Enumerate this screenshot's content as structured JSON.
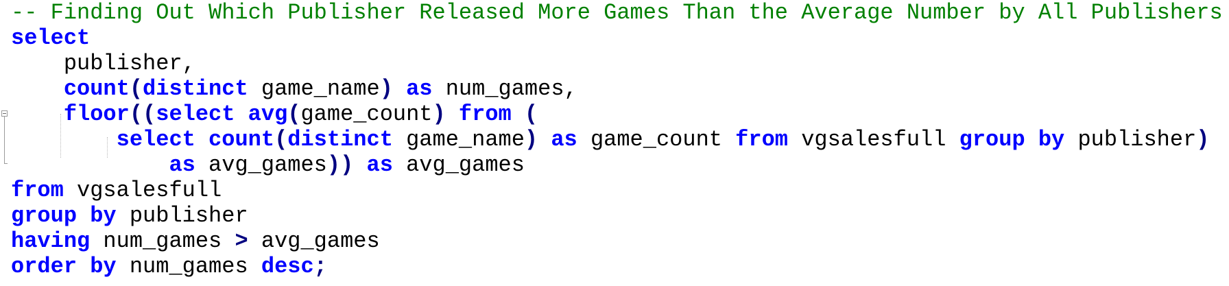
{
  "editor": {
    "lines": [
      [
        {
          "t": "comment",
          "v": "-- Finding Out Which Publisher Released More Games Than the Average Number by All Publishers"
        }
      ],
      [
        {
          "t": "kw",
          "v": "select"
        }
      ],
      [
        {
          "t": "id",
          "v": "    publisher,"
        }
      ],
      [
        {
          "t": "id",
          "v": "    "
        },
        {
          "t": "kw",
          "v": "count"
        },
        {
          "t": "op",
          "v": "("
        },
        {
          "t": "kw",
          "v": "distinct"
        },
        {
          "t": "id",
          "v": " game_name"
        },
        {
          "t": "op",
          "v": ")"
        },
        {
          "t": "id",
          "v": " "
        },
        {
          "t": "kw",
          "v": "as"
        },
        {
          "t": "id",
          "v": " num_games,"
        }
      ],
      [
        {
          "t": "id",
          "v": "    "
        },
        {
          "t": "kw",
          "v": "floor"
        },
        {
          "t": "op",
          "v": "(("
        },
        {
          "t": "kw",
          "v": "select"
        },
        {
          "t": "id",
          "v": " "
        },
        {
          "t": "kw",
          "v": "avg"
        },
        {
          "t": "op",
          "v": "("
        },
        {
          "t": "id",
          "v": "game_count"
        },
        {
          "t": "op",
          "v": ")"
        },
        {
          "t": "id",
          "v": " "
        },
        {
          "t": "kw",
          "v": "from"
        },
        {
          "t": "id",
          "v": " "
        },
        {
          "t": "op",
          "v": "("
        }
      ],
      [
        {
          "t": "id",
          "v": "        "
        },
        {
          "t": "kw",
          "v": "select"
        },
        {
          "t": "id",
          "v": " "
        },
        {
          "t": "kw",
          "v": "count"
        },
        {
          "t": "op",
          "v": "("
        },
        {
          "t": "kw",
          "v": "distinct"
        },
        {
          "t": "id",
          "v": " game_name"
        },
        {
          "t": "op",
          "v": ")"
        },
        {
          "t": "id",
          "v": " "
        },
        {
          "t": "kw",
          "v": "as"
        },
        {
          "t": "id",
          "v": " game_count "
        },
        {
          "t": "kw",
          "v": "from"
        },
        {
          "t": "id",
          "v": " vgsalesfull "
        },
        {
          "t": "kw",
          "v": "group by"
        },
        {
          "t": "id",
          "v": " publisher"
        },
        {
          "t": "op",
          "v": ")"
        }
      ],
      [
        {
          "t": "id",
          "v": "            "
        },
        {
          "t": "kw",
          "v": "as"
        },
        {
          "t": "id",
          "v": " avg_games"
        },
        {
          "t": "op",
          "v": "))"
        },
        {
          "t": "id",
          "v": " "
        },
        {
          "t": "kw",
          "v": "as"
        },
        {
          "t": "id",
          "v": " avg_games"
        }
      ],
      [
        {
          "t": "kw",
          "v": "from"
        },
        {
          "t": "id",
          "v": " vgsalesfull"
        }
      ],
      [
        {
          "t": "kw",
          "v": "group by"
        },
        {
          "t": "id",
          "v": " publisher"
        }
      ],
      [
        {
          "t": "kw",
          "v": "having"
        },
        {
          "t": "id",
          "v": " num_games "
        },
        {
          "t": "op",
          "v": ">"
        },
        {
          "t": "id",
          "v": " avg_games"
        }
      ],
      [
        {
          "t": "kw",
          "v": "order by"
        },
        {
          "t": "id",
          "v": " num_games "
        },
        {
          "t": "kw",
          "v": "desc"
        },
        {
          "t": "op",
          "v": ";"
        }
      ]
    ]
  },
  "colors": {
    "comment": "#008000",
    "keyword": "#0000ff",
    "operator": "#000080",
    "identifier": "#000000",
    "background": "#ffffff"
  },
  "icons": {
    "fold_marker": "fold-collapse-icon"
  }
}
